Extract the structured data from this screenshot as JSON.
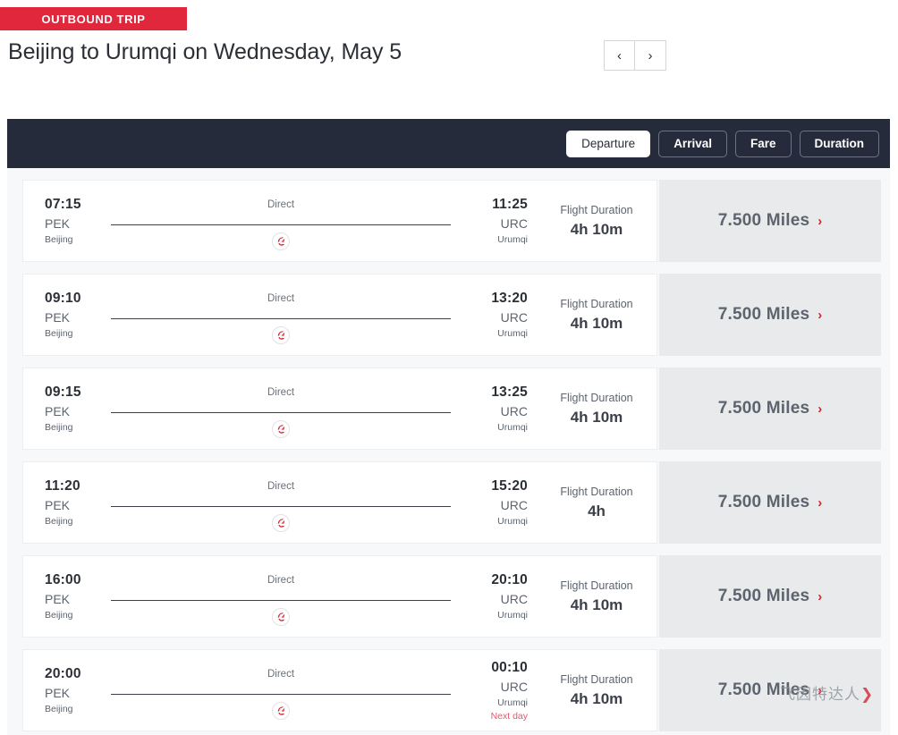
{
  "header": {
    "badge": "OUTBOUND TRIP",
    "title": "Beijing to Urumqi on Wednesday, May 5",
    "prev_icon": "‹",
    "next_icon": "›",
    "prev_label": "previous-day",
    "next_label": "next-day"
  },
  "sort": {
    "options": [
      {
        "label": "Departure",
        "active": true
      },
      {
        "label": "Arrival",
        "active": false
      },
      {
        "label": "Fare",
        "active": false
      },
      {
        "label": "Duration",
        "active": false
      }
    ]
  },
  "labels": {
    "duration_label": "Flight Duration",
    "stops": "Direct",
    "next_day": "Next day",
    "chevron": "›",
    "airline_logo": "air-china-phoenix"
  },
  "flights": [
    {
      "departure_time": "07:15",
      "departure_code": "PEK",
      "departure_city": "Beijing",
      "stops": "Direct",
      "arrival_time": "11:25",
      "arrival_code": "URC",
      "arrival_city": "Urumqi",
      "next_day": "",
      "duration_label": "Flight Duration",
      "duration": "4h 10m",
      "miles": "7.500 Miles"
    },
    {
      "departure_time": "09:10",
      "departure_code": "PEK",
      "departure_city": "Beijing",
      "stops": "Direct",
      "arrival_time": "13:20",
      "arrival_code": "URC",
      "arrival_city": "Urumqi",
      "next_day": "",
      "duration_label": "Flight Duration",
      "duration": "4h 10m",
      "miles": "7.500 Miles"
    },
    {
      "departure_time": "09:15",
      "departure_code": "PEK",
      "departure_city": "Beijing",
      "stops": "Direct",
      "arrival_time": "13:25",
      "arrival_code": "URC",
      "arrival_city": "Urumqi",
      "next_day": "",
      "duration_label": "Flight Duration",
      "duration": "4h 10m",
      "miles": "7.500 Miles"
    },
    {
      "departure_time": "11:20",
      "departure_code": "PEK",
      "departure_city": "Beijing",
      "stops": "Direct",
      "arrival_time": "15:20",
      "arrival_code": "URC",
      "arrival_city": "Urumqi",
      "next_day": "",
      "duration_label": "Flight Duration",
      "duration": "4h",
      "miles": "7.500 Miles"
    },
    {
      "departure_time": "16:00",
      "departure_code": "PEK",
      "departure_city": "Beijing",
      "stops": "Direct",
      "arrival_time": "20:10",
      "arrival_code": "URC",
      "arrival_city": "Urumqi",
      "next_day": "",
      "duration_label": "Flight Duration",
      "duration": "4h 10m",
      "miles": "7.500 Miles"
    },
    {
      "departure_time": "20:00",
      "departure_code": "PEK",
      "departure_city": "Beijing",
      "stops": "Direct",
      "arrival_time": "00:10",
      "arrival_code": "URC",
      "arrival_city": "Urumqi",
      "next_day": "Next day",
      "duration_label": "Flight Duration",
      "duration": "4h 10m",
      "miles": "7.500 Miles"
    }
  ],
  "watermark": {
    "text": "飞因特达人",
    "mark": "❯"
  },
  "colors": {
    "brand_red": "#e0273c",
    "header_dark": "#252b3a",
    "miles_panel": "#e8eaec",
    "page_bg": "#f7f8f9",
    "next_day": "#e4596b"
  }
}
